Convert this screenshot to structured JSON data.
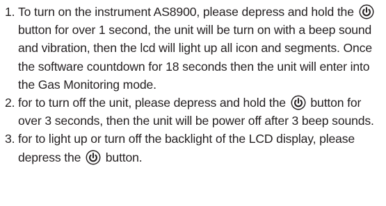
{
  "instructions": [
    {
      "number": "1.",
      "parts": [
        "To turn on the instrument AS8900, please depress and hold the",
        "button for over 1 second, the unit will be turn on with a beep sound and vibration, then the lcd will light up all icon and segments. Once the software countdown for 18 seconds then the unit will enter into the Gas Monitoring mode."
      ]
    },
    {
      "number": "2.",
      "parts": [
        "for to turn off the unit, please depress and hold the",
        "button for over 3 seconds, then the unit will be power off after 3 beep sounds."
      ]
    },
    {
      "number": "3.",
      "parts": [
        "for to light up or turn off the backlight of the LCD display, please depress the",
        "button."
      ]
    }
  ],
  "icon_name": "power-button-icon"
}
